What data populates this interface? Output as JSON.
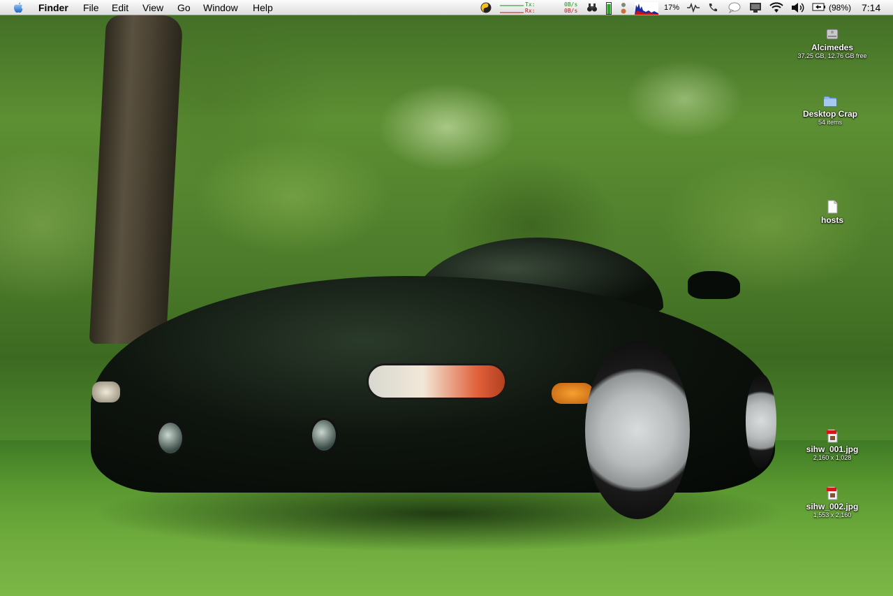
{
  "menubar": {
    "app_name": "Finder",
    "menus": [
      "File",
      "Edit",
      "View",
      "Go",
      "Window",
      "Help"
    ],
    "status": {
      "tx_label": "Tx:",
      "rx_label": "Rx:",
      "tx_rate": "0B/s",
      "rx_rate": "0B/s",
      "cpu_percent": "17%",
      "battery_percent": "(98%)",
      "clock": "7:14"
    },
    "icons": [
      "apple-icon",
      "yin-yang-icon",
      "binoculars-icon",
      "battery-meter-icon",
      "traffic-light-icon",
      "cpu-graph-icon",
      "activity-icon",
      "phone-icon",
      "chat-bubble-icon",
      "display-icon",
      "wifi-icon",
      "volume-icon",
      "battery-icon"
    ]
  },
  "desktop_icons": [
    {
      "name": "Alcimedes",
      "info": "37.25 GB, 12.76 GB free",
      "icon": "hard-drive-icon"
    },
    {
      "name": "Desktop Crap",
      "info": "54 items",
      "icon": "folder-icon"
    },
    {
      "name": "hosts",
      "info": "",
      "icon": "document-icon"
    },
    {
      "name": "sihw_001.jpg",
      "info": "2,160 x 1,028",
      "icon": "jpeg-file-icon"
    },
    {
      "name": "sihw_002.jpg",
      "info": "1,553 x 2,160",
      "icon": "jpeg-file-icon"
    }
  ],
  "colors": {
    "menubar_bg": "#ececec",
    "label_text": "#ffffff",
    "tx_color": "#1a8a1a",
    "rx_color": "#c01010"
  }
}
